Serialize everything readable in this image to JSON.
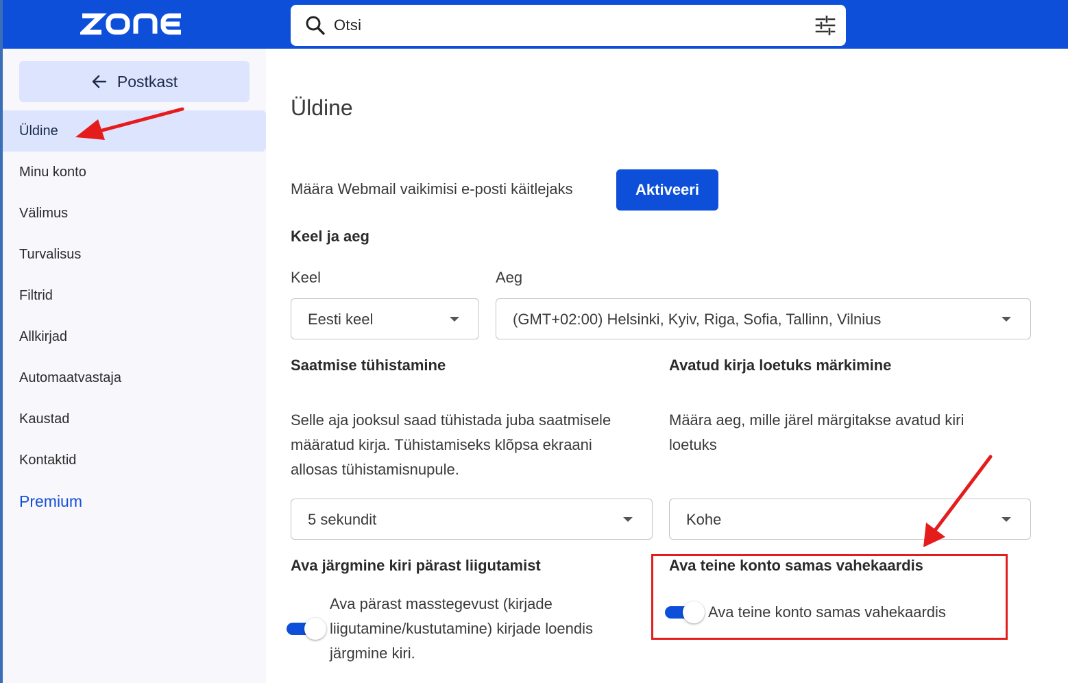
{
  "header": {
    "logo_text": "ZONE",
    "search": {
      "placeholder": "Otsi"
    }
  },
  "sidebar": {
    "back_label": "Postkast",
    "items": [
      {
        "label": "Üldine",
        "active": true
      },
      {
        "label": "Minu konto"
      },
      {
        "label": "Välimus"
      },
      {
        "label": "Turvalisus"
      },
      {
        "label": "Filtrid"
      },
      {
        "label": "Allkirjad"
      },
      {
        "label": "Automaatvastaja"
      },
      {
        "label": "Kaustad"
      },
      {
        "label": "Kontaktid"
      },
      {
        "label": "Premium",
        "premium": true
      }
    ]
  },
  "main": {
    "title": "Üldine",
    "webmail_text": "Määra Webmail vaikimisi e-posti käitlejaks",
    "activate_label": "Aktiveeri",
    "lang_time": {
      "title": "Keel ja aeg",
      "lang_label": "Keel",
      "lang_value": "Eesti keel",
      "time_label": "Aeg",
      "time_value": "(GMT+02:00) Helsinki, Kyiv, Riga, Sofia, Tallinn, Vilnius"
    },
    "undo_send": {
      "title": "Saatmise tühistamine",
      "desc_lines": [
        "Selle aja jooksul saad tühistada juba saatmisele",
        "määratud kirja. Tühistamiseks klõpsa ekraani",
        "allosas tühistamisnupule."
      ],
      "value": "5 sekundit"
    },
    "mark_read": {
      "title": "Avatud kirja loetuks märkimine",
      "desc_lines": [
        "Määra aeg, mille järel märgitakse avatud kiri",
        "loetuks"
      ],
      "value": "Kohe"
    },
    "next_mail": {
      "title": "Ava järgmine kiri pärast liigutamist",
      "toggle_lines": [
        "Ava pärast masstegevust (kirjade",
        "liigutamine/kustutamine) kirjade loendis",
        "järgmine kiri."
      ],
      "enabled": true
    },
    "same_tab": {
      "title": "Ava teine konto samas vahekaardis",
      "toggle_label": "Ava teine konto samas vahekaardis",
      "enabled": true
    }
  },
  "colors": {
    "brand": "#0d4fd9",
    "sidebar_active": "#dde4fd",
    "annotation": "#e51c1c"
  }
}
